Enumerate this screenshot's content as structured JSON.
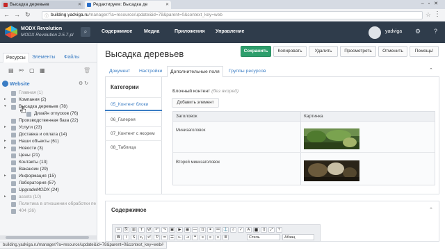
{
  "browser": {
    "tabs": [
      {
        "title": "Высадка деревьев"
      },
      {
        "title": "Редактируем: Высадка де"
      }
    ],
    "url_host": "building.yadviga.ru",
    "url_rest": "/manager/?a=resource/update&id=78&parent=0&context_key=web",
    "status_url": "building.yadviga.ru/manager/?a=resource/update&id=78&parent=0&context_key=web#"
  },
  "header": {
    "brand_title": "MODX Revolution",
    "brand_version": "MODX Revolution 2.5.7-pl",
    "nav": [
      "Содержимое",
      "Медиа",
      "Приложения",
      "Управление"
    ],
    "username": "yadviga"
  },
  "left": {
    "tabs": [
      "Ресурсы",
      "Элементы",
      "Файлы"
    ],
    "context": "Website",
    "tree": [
      {
        "label": "Главная (1)",
        "arrow": "",
        "dim": true
      },
      {
        "label": "Компания (2)",
        "arrow": "▸"
      },
      {
        "label": "Высадка деревьев (78)",
        "arrow": "▾",
        "sub": false
      },
      {
        "label": "Дизайн отпусков (76)",
        "arrow": "",
        "sub": true
      },
      {
        "label": "Производственная база (22)",
        "arrow": ""
      },
      {
        "label": "Услуги (23)",
        "arrow": "▸"
      },
      {
        "label": "Доставка и оплата (14)",
        "arrow": ""
      },
      {
        "label": "Наши объекты (61)",
        "arrow": "▸"
      },
      {
        "label": "Новости (3)",
        "arrow": "▸"
      },
      {
        "label": "Цены (21)",
        "arrow": ""
      },
      {
        "label": "Контакты (13)",
        "arrow": ""
      },
      {
        "label": "Вакансии (29)",
        "arrow": ""
      },
      {
        "label": "Информация (15)",
        "arrow": "▸"
      },
      {
        "label": "Лаборатория (57)",
        "arrow": ""
      },
      {
        "label": "UpgradeMODX (24)",
        "arrow": "",
        "italic": true
      },
      {
        "label": "assets (10)",
        "arrow": "▸",
        "dim": true
      },
      {
        "label": "Политика в отношении обработки пе",
        "arrow": "",
        "dim": true
      },
      {
        "label": "404 (26)",
        "arrow": "",
        "dim": true
      }
    ]
  },
  "main": {
    "title": "Высадка деревьев",
    "actions": [
      "Сохранить",
      "Копировать",
      "Удалить",
      "Просмотреть",
      "Отменить",
      "Помощь!"
    ],
    "tabs": [
      "Документ",
      "Настройки",
      "Дополнительные поля",
      "Группы ресурсов"
    ],
    "categories_head": "Категории",
    "categories": [
      "05_Контент блоки",
      "06_Галерея",
      "07_Контент с якорем",
      "08_Таблица"
    ],
    "tv_label": "Блочный контент",
    "tv_name": "(без якорей)",
    "add_button": "Добавить элемент",
    "grid": {
      "col_title": "Заголовок",
      "col_image": "Картинка",
      "rows": [
        {
          "title": "Минизаголовок"
        },
        {
          "title": "Второй минизаголовок"
        }
      ]
    },
    "content_head": "Содержимое",
    "editor": {
      "style_select": "Стиль",
      "format_select": "Абзац"
    }
  },
  "colors": {
    "header_bg": "#2f3c4b",
    "save_green": "#2e9e6c",
    "link_blue": "#3b7dc4"
  }
}
